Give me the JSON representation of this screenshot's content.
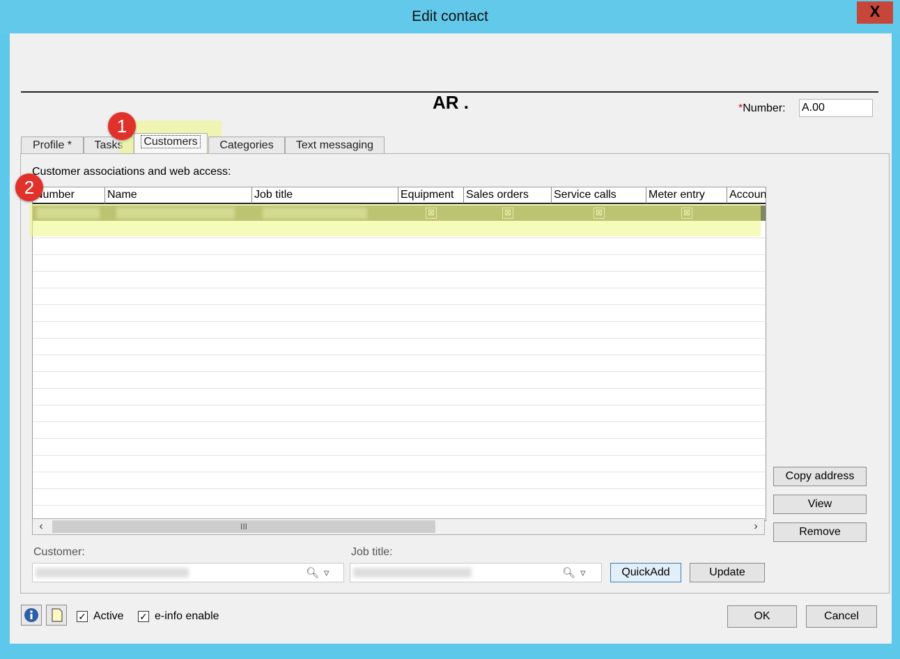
{
  "window": {
    "title": "Edit contact",
    "close_glyph": "X"
  },
  "contact": {
    "heading": "AR .",
    "number_required_mark": "*",
    "number_label": "Number:",
    "number_value": "A.00"
  },
  "tabs": [
    {
      "label": "Profile *"
    },
    {
      "label": "Tasks"
    },
    {
      "label": "Customers",
      "active": true
    },
    {
      "label": "Categories"
    },
    {
      "label": "Text messaging"
    }
  ],
  "customers_tab": {
    "section_label": "Customer associations and web access:",
    "columns": [
      "Number",
      "Name",
      "Job title",
      "Equipment",
      "Sales orders",
      "Service calls",
      "Meter entry",
      "Account"
    ],
    "selected_row": {
      "equipment": true,
      "sales_orders": true,
      "service_calls": true,
      "meter_entry": true
    },
    "scroll_grip": "III"
  },
  "side_buttons": {
    "copy_address": "Copy address",
    "view": "View",
    "remove": "Remove"
  },
  "form": {
    "customer_label": "Customer:",
    "job_title_label": "Job title:",
    "quickadd": "QuickAdd",
    "update": "Update"
  },
  "footer": {
    "active_label": "Active",
    "einfo_label": "e-info enable",
    "active_checked": true,
    "einfo_checked": true,
    "ok": "OK",
    "cancel": "Cancel"
  },
  "annotations": {
    "badge1": "1",
    "badge2": "2"
  },
  "colors": {
    "titlebar": "#62c9eb",
    "close": "#c7463a",
    "highlight": "#eef882",
    "badge": "#e0312b",
    "selected_row": "#7f8660"
  }
}
